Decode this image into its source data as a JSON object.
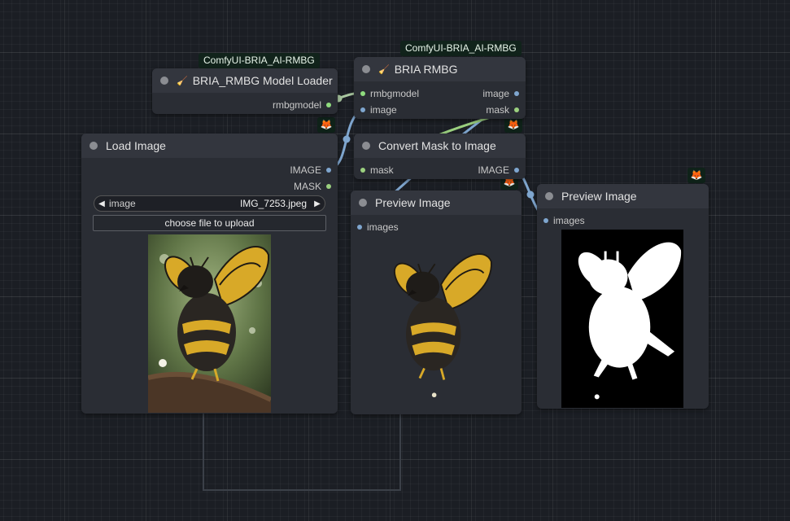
{
  "badges": {
    "loader_pack": "ComfyUI-BRIA_AI-RMBG",
    "rmbg_pack": "ComfyUI-BRIA_AI-RMBG"
  },
  "emoji_badge": "🦊",
  "nodes": {
    "loader": {
      "title": "BRIA_RMBG Model Loader",
      "outputs": [
        "rmbgmodel"
      ]
    },
    "rmbg": {
      "title": "BRIA RMBG",
      "inputs": [
        "rmbgmodel",
        "image"
      ],
      "outputs": [
        "image",
        "mask"
      ]
    },
    "load_image": {
      "title": "Load Image",
      "outputs": [
        "IMAGE",
        "MASK"
      ],
      "widget_label": "image",
      "widget_value": "IMG_7253.jpeg",
      "upload_label": "choose file to upload"
    },
    "convert": {
      "title": "Convert Mask to Image",
      "inputs": [
        "mask"
      ],
      "outputs": [
        "IMAGE"
      ]
    },
    "preview1": {
      "title": "Preview Image",
      "inputs": [
        "images"
      ]
    },
    "preview2": {
      "title": "Preview Image",
      "inputs": [
        "images"
      ]
    }
  },
  "colors": {
    "canvas": "#1b1e24",
    "node_body": "#2a2d34",
    "node_title": "#33363e",
    "badge_bg": "#11231b",
    "link_blue": "#7fa6cf",
    "link_green": "#9bd07f",
    "link_sage": "#a9c7a0"
  }
}
